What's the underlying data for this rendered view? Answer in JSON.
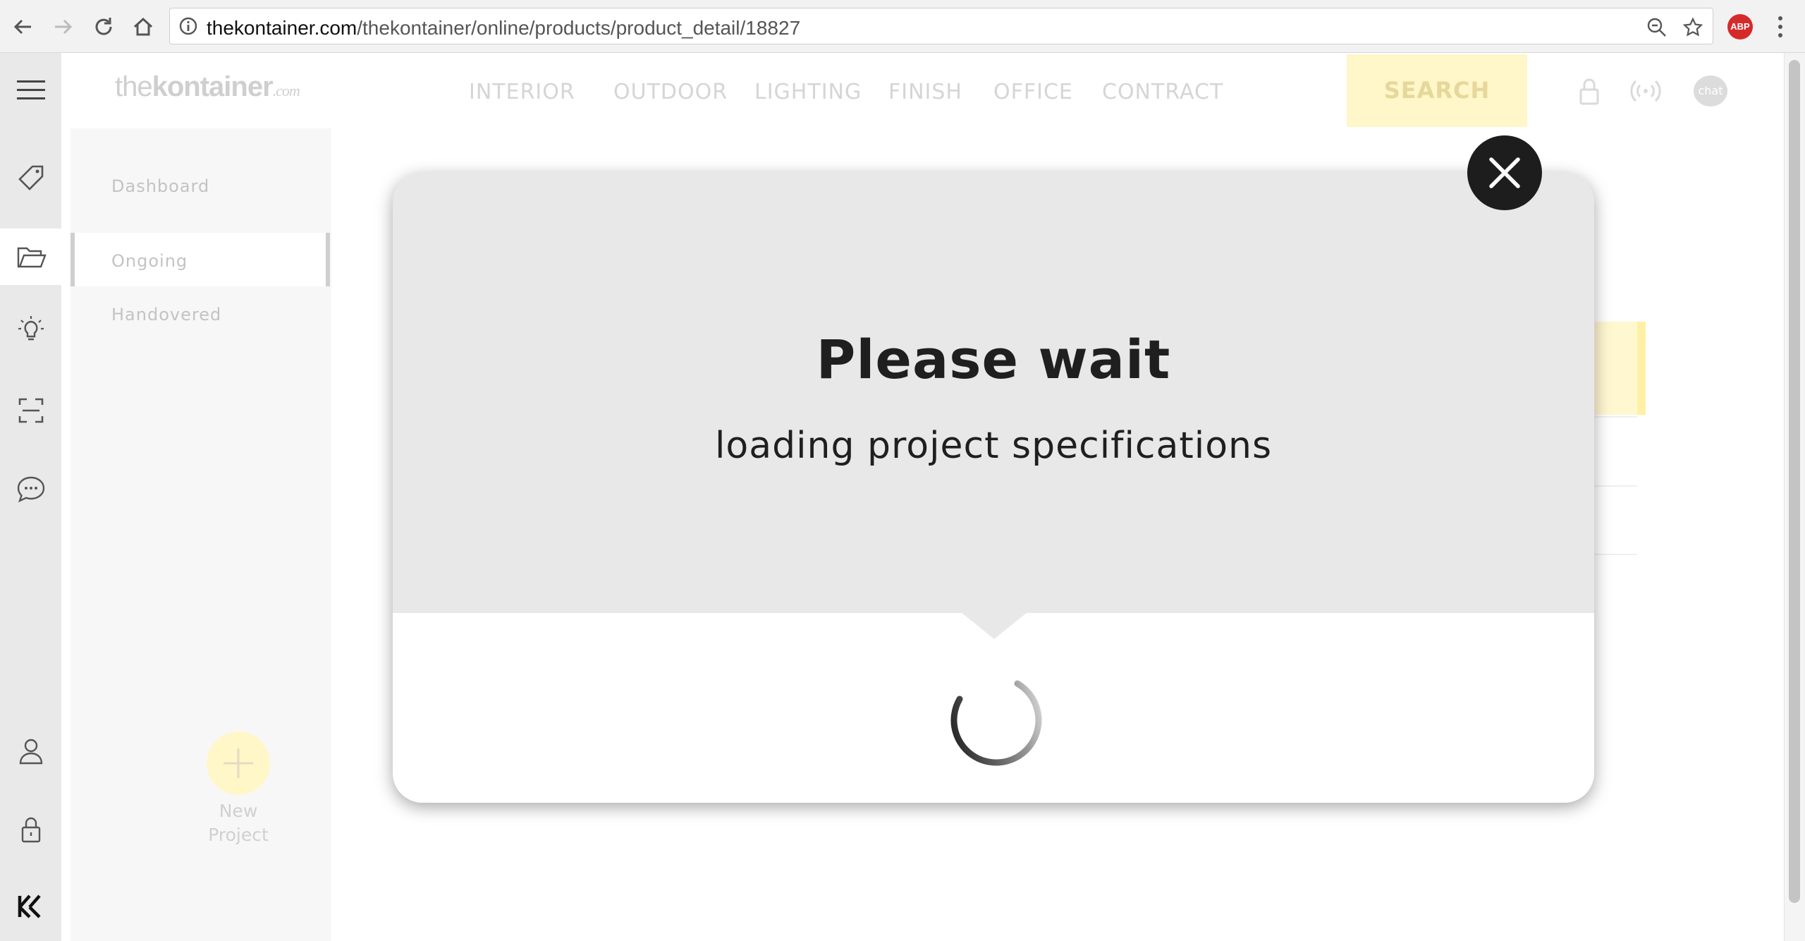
{
  "browser": {
    "url_host": "thekontainer.com",
    "url_path": "/thekontainer/online/products/product_detail/18827",
    "adblock_label": "ABP"
  },
  "header": {
    "logo": {
      "part1": "the",
      "part2": "kontainer",
      "part3": ".com"
    },
    "nav": [
      "INTERIOR",
      "OUTDOOR",
      "LIGHTING",
      "FINISH",
      "OFFICE",
      "CONTRACT"
    ],
    "search_label": "SEARCH",
    "chat_label": "chat"
  },
  "sidebar": {
    "items": [
      {
        "label": "Dashboard"
      },
      {
        "label": "Ongoing"
      },
      {
        "label": "Handovered"
      }
    ],
    "new_project": {
      "line1": "New",
      "line2": "Project"
    }
  },
  "modal": {
    "title": "Please wait",
    "subtitle": "loading project specifications"
  },
  "colors": {
    "accent_yellow": "#fff6c9",
    "modal_top": "#e8e8e8",
    "close_button": "#1d1d1d",
    "adblock": "#d62a2a"
  }
}
